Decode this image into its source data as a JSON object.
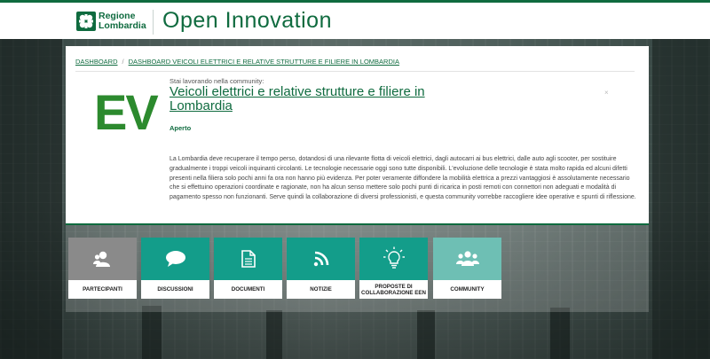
{
  "header": {
    "brand_line1": "Regione",
    "brand_line2": "Lombardia",
    "app_title_main": "Open Innov",
    "app_title_rest": "ation",
    "brand_color": "#0f6b3f"
  },
  "breadcrumb": {
    "items": [
      "DASHBOARD",
      "DASHBOARD VEICOLI ELETTRICI E RELATIVE STRUTTURE E FILIERE IN LOMBARDIA"
    ]
  },
  "community": {
    "logo_text": "EV",
    "working_label": "Stai lavorando nella community:",
    "title": "Veicoli elettrici e relative strutture e filiere in Lombardia",
    "status": "Aperto",
    "close_glyph": "×",
    "description": "La Lombardia deve recuperare il tempo perso, dotandosi di una rilevante flotta di veicoli elettrici, dagli autocarri ai bus elettrici, dalle auto agli scooter, per sostituire gradualmente i troppi veicoli inquinanti circolanti. Le tecnologie necessarie oggi sono tutte disponibili. L'evoluzione delle tecnologie è stata molto rapida ed alcuni difetti presenti nella filiera solo pochi anni fa ora non hanno più evidenza. Per poter veramente diffondere la mobilità elettrica a prezzi vantaggiosi è assolutamente necessario che si effettuino operazioni coordinate e ragionate, non ha alcun senso mettere solo pochi punti di ricarica in posti remoti con connettori non adeguati e modalità di pagamento spesso non funzionanti. Serve quindi la collaborazione di diversi professionisti, e questa community vorrebbe raccogliere idee operative e spunti di riflessione."
  },
  "tiles": [
    {
      "label": "PARTECIPANTI",
      "icon": "participants-icon",
      "color": "#8a8a8a"
    },
    {
      "label": "DISCUSSIONI",
      "icon": "chat-bubble-icon",
      "color": "#139d8a"
    },
    {
      "label": "DOCUMENTI",
      "icon": "document-icon",
      "color": "#139d8a"
    },
    {
      "label": "NOTIZIE",
      "icon": "rss-icon",
      "color": "#139d8a"
    },
    {
      "label": "PROPOSTE DI COLLABORAZIONE EEN",
      "icon": "lightbulb-icon",
      "color": "#139d8a"
    },
    {
      "label": "COMMUNITY",
      "icon": "community-icon",
      "color": "#6ebfb4"
    }
  ]
}
